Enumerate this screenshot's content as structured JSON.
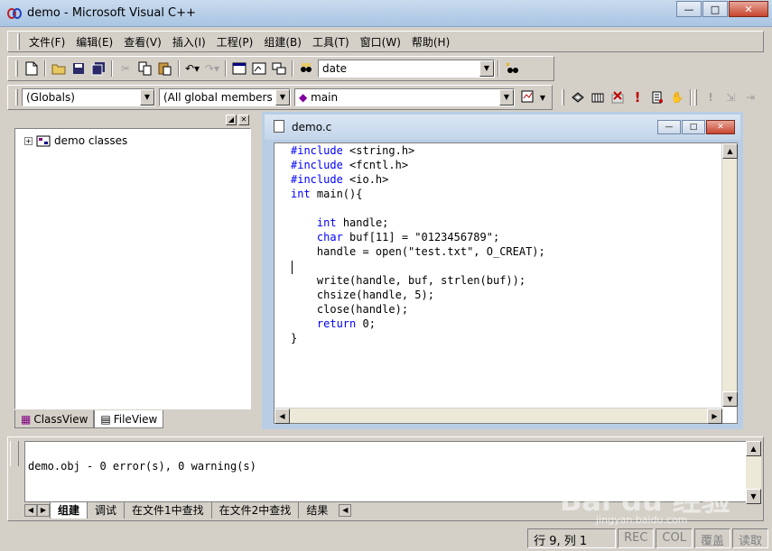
{
  "window": {
    "title": "demo - Microsoft Visual C++",
    "controls": {
      "minimize": "—",
      "maximize": "□",
      "close": "✕"
    }
  },
  "menu": {
    "items": [
      "文件(F)",
      "编辑(E)",
      "查看(V)",
      "插入(I)",
      "工程(P)",
      "组建(B)",
      "工具(T)",
      "窗口(W)",
      "帮助(H)"
    ]
  },
  "toolbar": {
    "find_combo_value": "date"
  },
  "wizardbar": {
    "class_combo": "(Globals)",
    "filter_combo": "(All global members",
    "members_combo": "main"
  },
  "workspace": {
    "root_node": "demo classes",
    "tabs": [
      "ClassView",
      "FileView"
    ]
  },
  "editor": {
    "document_title": "demo.c",
    "code_lines": [
      "#include <string.h>",
      "#include <fcntl.h>",
      "#include <io.h>",
      "int main(){",
      "",
      "    int handle;",
      "    char buf[11] = \"0123456789\";",
      "    handle = open(\"test.txt\", O_CREAT);",
      "",
      "    write(handle, buf, strlen(buf));",
      "    chsize(handle, 5);",
      "    close(handle);",
      "    return 0;",
      "}"
    ]
  },
  "output": {
    "message": "demo.obj - 0 error(s), 0 warning(s)",
    "tabs": [
      "组建",
      "调试",
      "在文件1中查找",
      "在文件2中查找",
      "结果"
    ]
  },
  "statusbar": {
    "position": "行 9, 列 1",
    "rec": "REC",
    "col": "COL",
    "ovr": "覆盖",
    "read": "读取"
  },
  "watermark": {
    "text": "Bai du 经验",
    "sub": "jingyan.baidu.com"
  }
}
